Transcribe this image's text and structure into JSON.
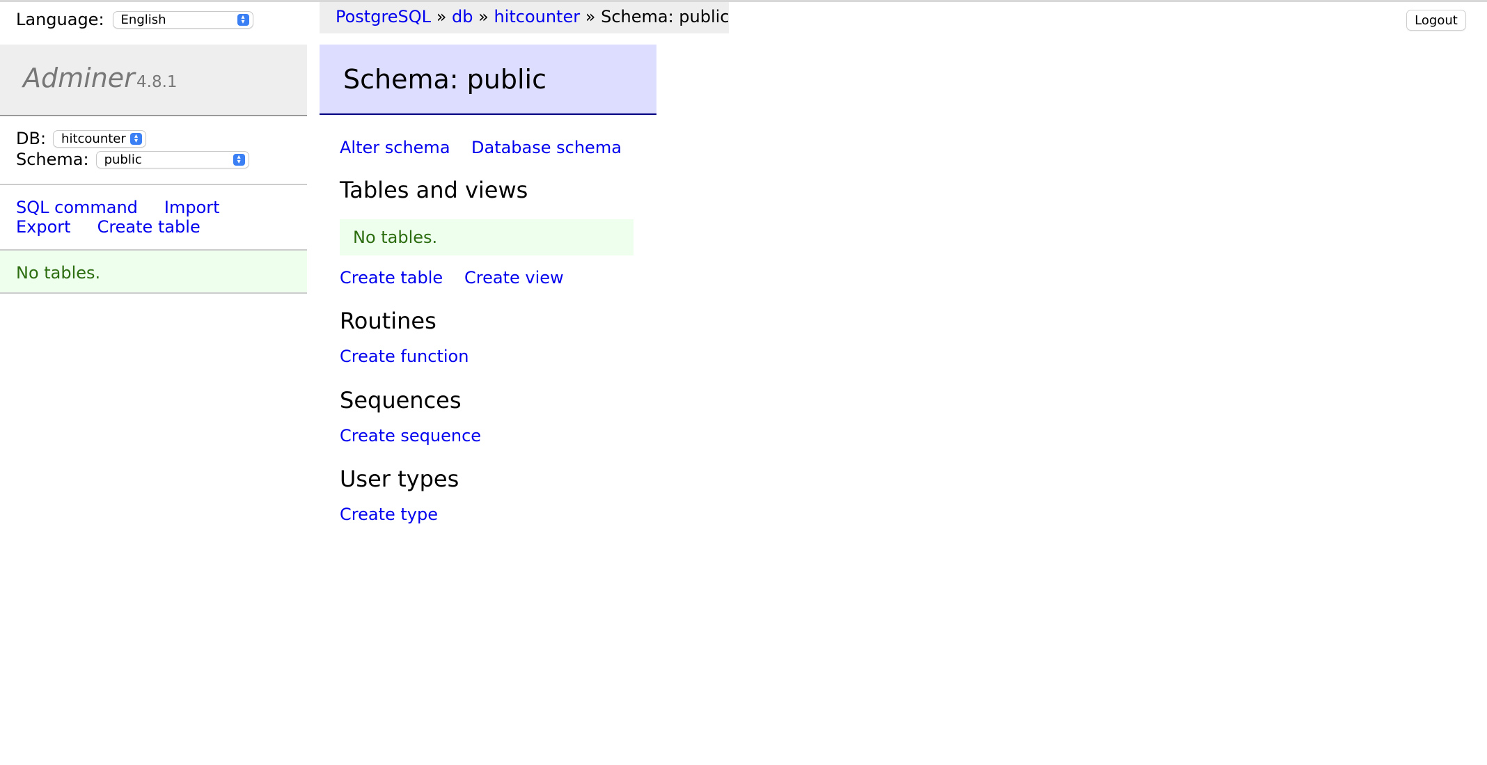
{
  "sidebar": {
    "language_label": "Language:",
    "language_value": "English",
    "app_name": "Adminer",
    "version": "4.8.1",
    "db_label": "DB:",
    "db_value": "hitcounter",
    "schema_label": "Schema:",
    "schema_value": "public",
    "links": {
      "sql_command": "SQL command",
      "import": "Import",
      "export": "Export",
      "create_table": "Create table"
    },
    "no_tables": "No tables."
  },
  "breadcrumb": {
    "system": "PostgreSQL",
    "sep": "»",
    "server": "db",
    "database": "hitcounter",
    "current": "Schema: public"
  },
  "logout_label": "Logout",
  "main": {
    "title": "Schema: public",
    "alter_schema": "Alter schema",
    "database_schema": "Database schema",
    "tables_heading": "Tables and views",
    "no_tables": "No tables.",
    "create_table": "Create table",
    "create_view": "Create view",
    "routines_heading": "Routines",
    "create_function": "Create function",
    "sequences_heading": "Sequences",
    "create_sequence": "Create sequence",
    "user_types_heading": "User types",
    "create_type": "Create type"
  },
  "colors": {
    "link": "#0000ee",
    "page_head_bg": "#ddddff",
    "success_bg": "#eeffee",
    "success_text": "#2c6e0f"
  }
}
